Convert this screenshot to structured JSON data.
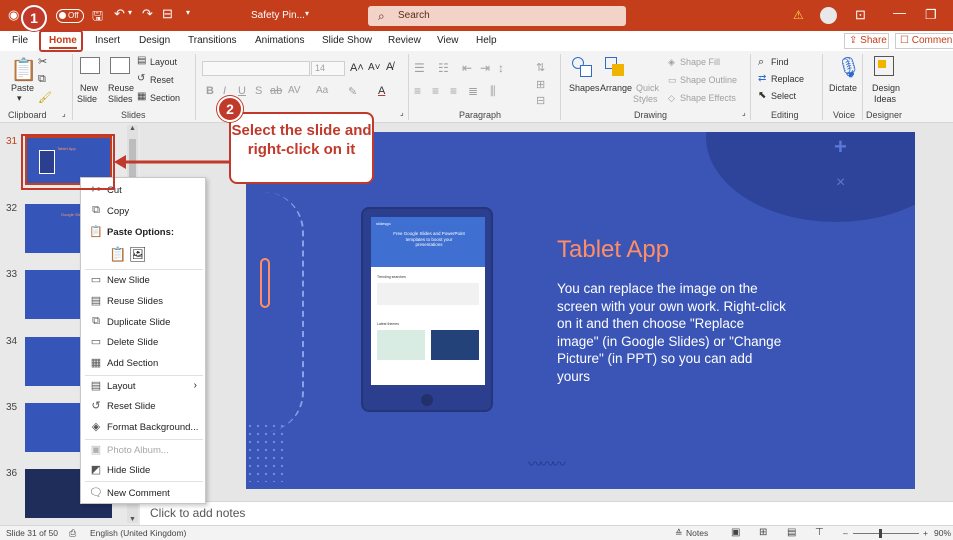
{
  "titlebar": {
    "autosave_label": "Off",
    "doc_title": "Safety Pin...",
    "search_placeholder": "Search"
  },
  "tabs": [
    {
      "label": "File"
    },
    {
      "label": "Home"
    },
    {
      "label": "Insert"
    },
    {
      "label": "Design"
    },
    {
      "label": "Transitions"
    },
    {
      "label": "Animations"
    },
    {
      "label": "Slide Show"
    },
    {
      "label": "Review"
    },
    {
      "label": "View"
    },
    {
      "label": "Help"
    }
  ],
  "share_label": "Share",
  "comments_label": "Commen",
  "ribbon": {
    "paste": "Paste",
    "clipboard": "Clipboard",
    "new_slide_1": "New",
    "new_slide_2": "Slide",
    "reuse_1": "Reuse",
    "reuse_2": "Slides",
    "layout": "Layout",
    "reset": "Reset",
    "section": "Section",
    "slides": "Slides",
    "font_size": "14",
    "font_group": "Font",
    "paragraph": "Paragraph",
    "shapes": "Shapes",
    "arrange": "Arrange",
    "quick_1": "Quick",
    "quick_2": "Styles",
    "shape_fill": "Shape Fill",
    "shape_outline": "Shape Outline",
    "shape_effects": "Shape Effects",
    "drawing": "Drawing",
    "find": "Find",
    "replace": "Replace",
    "select": "Select",
    "editing": "Editing",
    "dictate": "Dictate",
    "voice": "Voice",
    "design_ideas_1": "Design",
    "design_ideas_2": "Ideas",
    "designer": "Designer"
  },
  "thumbnails": [
    {
      "num": "31",
      "title": "Tablet App"
    },
    {
      "num": "32",
      "title": "Google Slides"
    },
    {
      "num": "33",
      "title": ""
    },
    {
      "num": "34",
      "title": ""
    },
    {
      "num": "35",
      "title": ""
    },
    {
      "num": "36",
      "title": ""
    }
  ],
  "context_menu": {
    "cut": "Cut",
    "copy": "Copy",
    "paste_options": "Paste Options:",
    "new_slide": "New Slide",
    "reuse_slides": "Reuse Slides",
    "duplicate_slide": "Duplicate Slide",
    "delete_slide": "Delete Slide",
    "add_section": "Add Section",
    "layout": "Layout",
    "reset_slide": "Reset Slide",
    "format_background": "Format Background...",
    "photo_album": "Photo Album...",
    "hide_slide": "Hide Slide",
    "new_comment": "New Comment"
  },
  "slide": {
    "title": "Tablet App",
    "body": "You can replace the image on the screen with your own work. Right-click on it and then choose \"Replace image\" (in Google Slides) or \"Change Picture\" (in PPT) so you can add yours",
    "screen_logo": "slidesgo",
    "screen_headline": "Free Google Slides and PowerPoint templates to boost your presentations",
    "screen_section1": "Trending searches",
    "screen_section2": "Latest themes"
  },
  "notes_placeholder": "Click to add notes",
  "statusbar": {
    "slide_count": "Slide 31 of 50",
    "language": "English (United Kingdom)",
    "notes": "Notes",
    "zoom": "90%"
  },
  "callouts": {
    "step1": "1",
    "step2": "2",
    "instruction": "Select the slide and right-click on it"
  },
  "colors": {
    "accent": "#c43e1c",
    "callout": "#c0392b",
    "slide_bg": "#3a55b5",
    "slide_title": "#ff8e67"
  }
}
